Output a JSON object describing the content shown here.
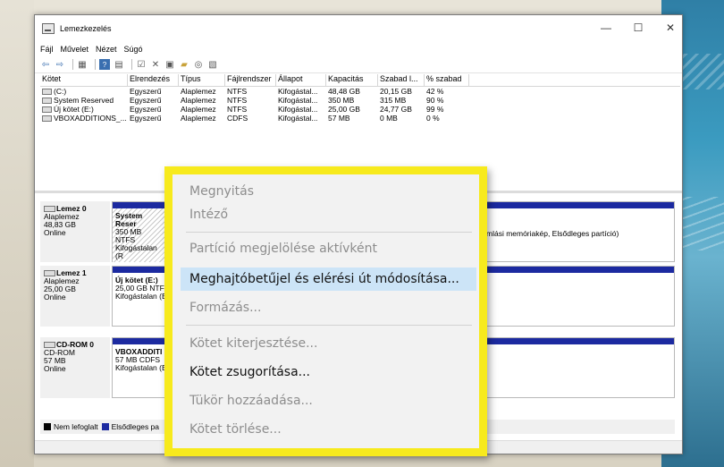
{
  "window": {
    "title": "Lemezkezelés",
    "controls": {
      "minimize": "—",
      "maximize": "☐",
      "close": "✕"
    }
  },
  "menu": [
    "Fájl",
    "Művelet",
    "Nézet",
    "Súgó"
  ],
  "volume_table": {
    "headers": [
      "Kötet",
      "Elrendezés",
      "Típus",
      "Fájlrendszer",
      "Állapot",
      "Kapacitás",
      "Szabad l...",
      "% szabad"
    ],
    "rows": [
      [
        "(C:)",
        "Egyszerű",
        "Alaplemez",
        "NTFS",
        "Kifogástal...",
        "48,48 GB",
        "20,15 GB",
        "42 %"
      ],
      [
        "System Reserved",
        "Egyszerű",
        "Alaplemez",
        "NTFS",
        "Kifogástal...",
        "350 MB",
        "315 MB",
        "90 %"
      ],
      [
        "Új kötet (E:)",
        "Egyszerű",
        "Alaplemez",
        "NTFS",
        "Kifogástal...",
        "25,00 GB",
        "24,77 GB",
        "99 %"
      ],
      [
        "VBOXADDITIONS_...",
        "Egyszerű",
        "Alaplemez",
        "CDFS",
        "Kifogástal...",
        "57 MB",
        "0 MB",
        "0 %"
      ]
    ]
  },
  "disks": [
    {
      "name": "Lemez 0",
      "type": "Alaplemez",
      "size": "48,83 GB",
      "status": "Online",
      "partition": {
        "name": "System Reser",
        "detail": "350 MB NTFS",
        "state": "Kifogástalan (R"
      },
      "right_text": "mlási memóriakép, Elsődleges partíció)"
    },
    {
      "name": "Lemez 1",
      "type": "Alaplemez",
      "size": "25,00 GB",
      "status": "Online",
      "partition": {
        "name": "Új kötet (E:)",
        "detail": "25,00 GB NTFS",
        "state": "Kifogástalan (E"
      }
    },
    {
      "name": "CD-ROM 0",
      "type": "CD-ROM",
      "size": "57 MB",
      "status": "Online",
      "partition": {
        "name": "VBOXADDITI",
        "detail": "57 MB CDFS",
        "state": "Kifogástalan (E"
      }
    }
  ],
  "legend": [
    {
      "label": "Nem lefoglalt",
      "color": "#000000"
    },
    {
      "label": "Elsődleges pa",
      "color": "#1c2aa0"
    }
  ],
  "context_menu": {
    "items": [
      {
        "label": "Megnyitás",
        "enabled": false
      },
      {
        "label": "Intéző",
        "enabled": false
      },
      {
        "label": "Partíció megjelölése aktívként",
        "enabled": false
      },
      {
        "label": "Meghajtóbetűjel és elérési út módosítása...",
        "enabled": true,
        "highlighted": true
      },
      {
        "label": "Formázás...",
        "enabled": false
      },
      {
        "label": "Kötet kiterjesztése...",
        "enabled": false
      },
      {
        "label": "Kötet zsugorítása...",
        "enabled": true
      },
      {
        "label": "Tükör hozzáadása...",
        "enabled": false
      },
      {
        "label": "Kötet törlése...",
        "enabled": false
      }
    ],
    "highlight_color": "#f7ea1d"
  }
}
